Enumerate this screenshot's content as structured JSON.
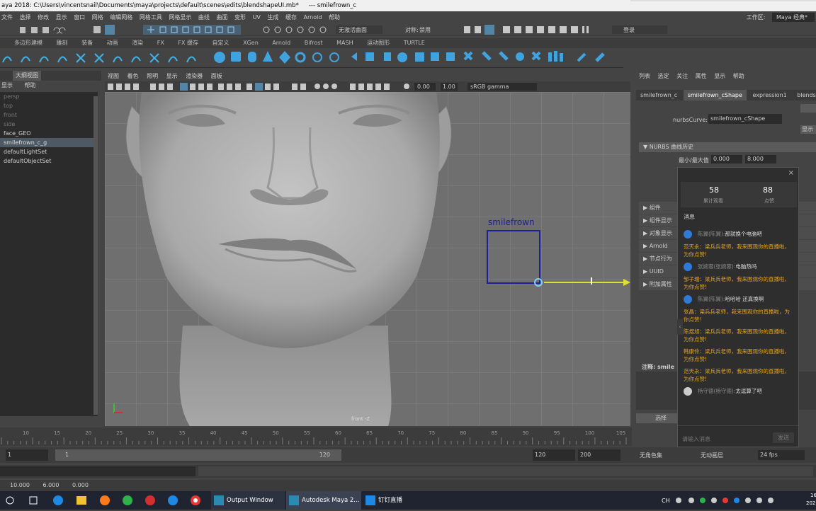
{
  "window": {
    "title": "aya 2018: C:\\Users\\vincentsnail\\Documents\\maya\\projects\\default\\scenes\\edits\\blendshapeUI.mb*",
    "title_suffix": "---  smilefrown_c"
  },
  "menubar": {
    "items": [
      "文件",
      "选择",
      "修改",
      "显示",
      "窗口",
      "网格",
      "编辑网格",
      "网格工具",
      "网格显示",
      "曲线",
      "曲面",
      "变形",
      "UV",
      "生成",
      "缓存",
      "Arnold",
      "帮助"
    ],
    "workspace_label": "工作区:",
    "workspace_value": "Maya 经典*"
  },
  "statusline": {
    "curve_mode": "无激活曲面",
    "symmetry_label": "对称:",
    "symmetry_value": "禁用",
    "login": "登录"
  },
  "shelf_tabs": [
    "多边形建模",
    "雕刻",
    "装备",
    "动画",
    "渲染",
    "FX",
    "FX 缓存",
    "自定义",
    "XGen",
    "Arnold",
    "Bifrost",
    "MASH",
    "运动图形",
    "TURTLE"
  ],
  "outliner": {
    "tab_label": "大纲视图",
    "menu": [
      "显示",
      "帮助"
    ],
    "items": [
      "persp",
      "top",
      "front",
      "side",
      "face_GEO",
      "smilefrown_c_g",
      "defaultLightSet",
      "defaultObjectSet"
    ],
    "selected_index": 5,
    "grey_items": [
      0,
      1,
      2,
      3
    ]
  },
  "viewport": {
    "menu": [
      "视图",
      "着色",
      "照明",
      "显示",
      "渲染器",
      "面板"
    ],
    "exposure": "0.00",
    "gamma": "1.00",
    "color_space": "sRGB gamma",
    "object_label": "smilefrown",
    "camera_label": "front -Z"
  },
  "timeline": {
    "ticks": [
      "10",
      "15",
      "20",
      "25",
      "30",
      "35",
      "40",
      "45",
      "50",
      "55",
      "60",
      "65",
      "70",
      "75",
      "80",
      "85",
      "90",
      "95",
      "100",
      "105"
    ]
  },
  "range": {
    "start": "1",
    "inner_start": "1",
    "inner_end": "120",
    "end": "120",
    "max": "200",
    "char_set": "无角色集",
    "anim_layer": "无动画层",
    "fps": "24 fps"
  },
  "helpline": {
    "values": [
      "10.000",
      "6.000",
      "0.000"
    ]
  },
  "attr_editor": {
    "menu": [
      "列表",
      "选定",
      "关注",
      "属性",
      "显示",
      "帮助"
    ],
    "tabs": [
      "smilefrown_c",
      "smilefrown_cShape",
      "expression1",
      "blends"
    ],
    "node_type_label": "nurbsCurve:",
    "node_name": "smilefrown_cShape",
    "section": "NURBS 曲线历史",
    "minmax_label": "最小/最大值",
    "minmax_min": "0.000",
    "minmax_max": "8.000",
    "collapsed": [
      "组件",
      "组件显示",
      "对象显示",
      "Arnold",
      "节点行为",
      "UUID",
      "附加属性"
    ],
    "notes_label": "注释: smile",
    "bottom_button": "选择",
    "side_buttons": [
      "显示"
    ]
  },
  "popup": {
    "views_count": "58",
    "views_label": "累计观看",
    "likes_count": "88",
    "likes_label": "点赞",
    "messages_title": "消息",
    "messages": [
      {
        "user": "陈翼(陈翼):",
        "text": "那就换个电脑吧",
        "kind": "chat"
      },
      {
        "user": "",
        "text": "范天永：梁兵兵老师，我来围观你的直播啦，为你点赞!",
        "kind": "system"
      },
      {
        "user": "张婉蓉(张婉蓉):",
        "text": "电脑热吗",
        "kind": "chat"
      },
      {
        "user": "",
        "text": "邹子瑞：梁兵兵老师，我来围观你的直播啦，为你点赞!",
        "kind": "system"
      },
      {
        "user": "陈翼(陈翼):",
        "text": "哈哈哈 还真换啊",
        "kind": "chat"
      },
      {
        "user": "",
        "text": "张晶：梁兵兵老师，我来围观你的直播啦，为你点赞!",
        "kind": "system"
      },
      {
        "user": "",
        "text": "陈煜旭：梁兵兵老师，我来围观你的直播啦，为你点赞!",
        "kind": "system"
      },
      {
        "user": "",
        "text": "韩康伶：梁兵兵老师，我来围观你的直播啦，为你点赞!",
        "kind": "system"
      },
      {
        "user": "",
        "text": "范天永：梁兵兵老师，我来围观你的直播啦，为你点赞!",
        "kind": "system"
      },
      {
        "user": "杨守德(杨守德):",
        "text": "太逗算了吧",
        "kind": "avatar"
      }
    ],
    "input_placeholder": "请输入消息",
    "send_label": "发送"
  },
  "taskbar": {
    "apps": [
      "Output Window",
      "Autodesk Maya 2...",
      "钉钉直播"
    ],
    "time": "16",
    "date": "202"
  },
  "colors": {
    "maya_bg": "#444444",
    "selection_blue": "#4d5a66",
    "curve_blue": "#1f1f9a",
    "popup_blue": "#2f7ad8",
    "popup_orange": "#e8a21a"
  }
}
